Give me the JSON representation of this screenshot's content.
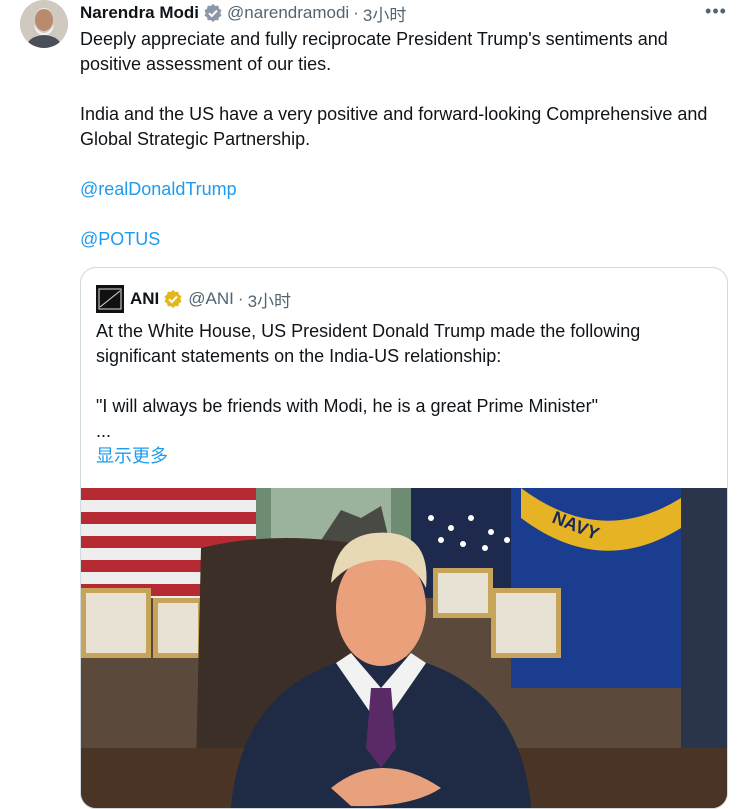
{
  "author": {
    "name": "Narendra Modi",
    "handle": "@narendramodi",
    "separator": "·",
    "time": "3小时",
    "verified": true,
    "more_icon": "more-horizontal-icon"
  },
  "tweet": {
    "para1": "Deeply appreciate and fully reciprocate President Trump's sentiments and positive assessment of our ties.",
    "para2": "India and the US have a very positive and forward-looking Comprehensive and Global Strategic Partnership.",
    "mention1": "@realDonaldTrump",
    "mention2": "@POTUS"
  },
  "quoted": {
    "name": "ANI",
    "handle": "@ANI",
    "separator": "·",
    "time": "3小时",
    "logo_text": "ANI",
    "verified": "gold",
    "line1": "At the White House, US President Donald Trump made the following significant statements on the India-US relationship:",
    "line2": "\"I will always be friends with Modi, he is a great Prime Minister\"",
    "ellipsis": "...",
    "show_more": "显示更多",
    "photo_text": "NAVY"
  },
  "colors": {
    "link": "#1d9bf0",
    "muted": "#536471",
    "border": "#cfd9de",
    "verified_blue": "#1d9bf0",
    "verified_gold": "#e2b719"
  }
}
